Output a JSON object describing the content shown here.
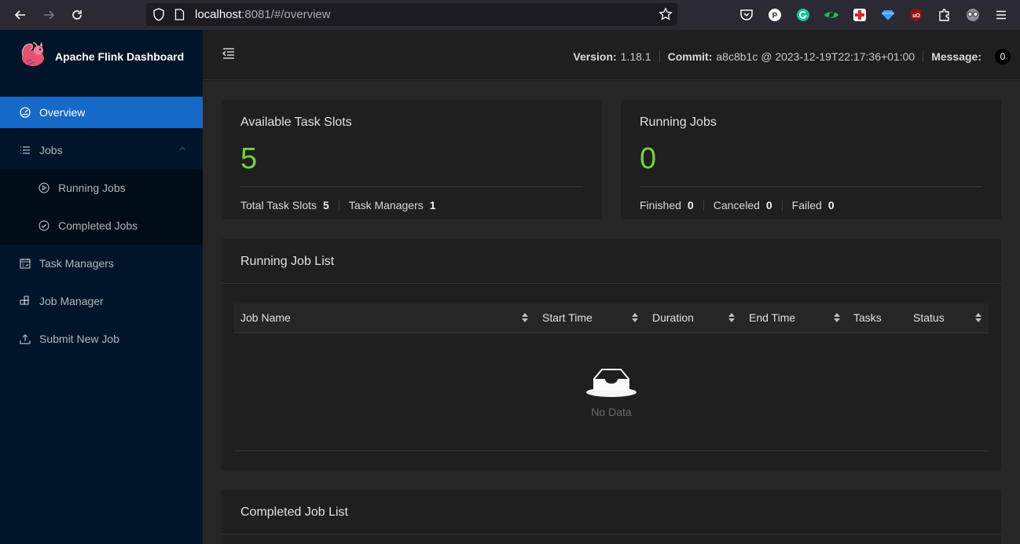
{
  "browser": {
    "url_host": "localhost",
    "url_rest": ":8081/#/overview"
  },
  "sidebar": {
    "brand": "Apache Flink Dashboard",
    "items": [
      {
        "label": "Overview",
        "icon": "dashboard-icon"
      },
      {
        "label": "Jobs",
        "icon": "unordered-list-icon"
      },
      {
        "label": "Running Jobs",
        "icon": "play-circle-icon"
      },
      {
        "label": "Completed Jobs",
        "icon": "check-circle-icon"
      },
      {
        "label": "Task Managers",
        "icon": "schedule-icon"
      },
      {
        "label": "Job Manager",
        "icon": "build-icon"
      },
      {
        "label": "Submit New Job",
        "icon": "upload-icon"
      }
    ]
  },
  "header": {
    "version_label": "Version:",
    "version": "1.18.1",
    "commit_label": "Commit:",
    "commit": "a8c8b1c @ 2023-12-19T22:17:36+01:00",
    "message_label": "Message:",
    "message_count": "0"
  },
  "slots_card": {
    "title": "Available Task Slots",
    "value": "5",
    "total_label": "Total Task Slots",
    "total_value": "5",
    "tm_label": "Task Managers",
    "tm_value": "1"
  },
  "jobs_card": {
    "title": "Running Jobs",
    "value": "0",
    "finished_label": "Finished",
    "finished_value": "0",
    "canceled_label": "Canceled",
    "canceled_value": "0",
    "failed_label": "Failed",
    "failed_value": "0"
  },
  "running_list": {
    "title": "Running Job List",
    "columns": [
      "Job Name",
      "Start Time",
      "Duration",
      "End Time",
      "Tasks",
      "Status"
    ],
    "empty_text": "No Data"
  },
  "completed_list": {
    "title": "Completed Job List"
  },
  "colors": {
    "accent": "#1769c7",
    "success": "#73d13d",
    "sidebar_bg": "#001529"
  }
}
